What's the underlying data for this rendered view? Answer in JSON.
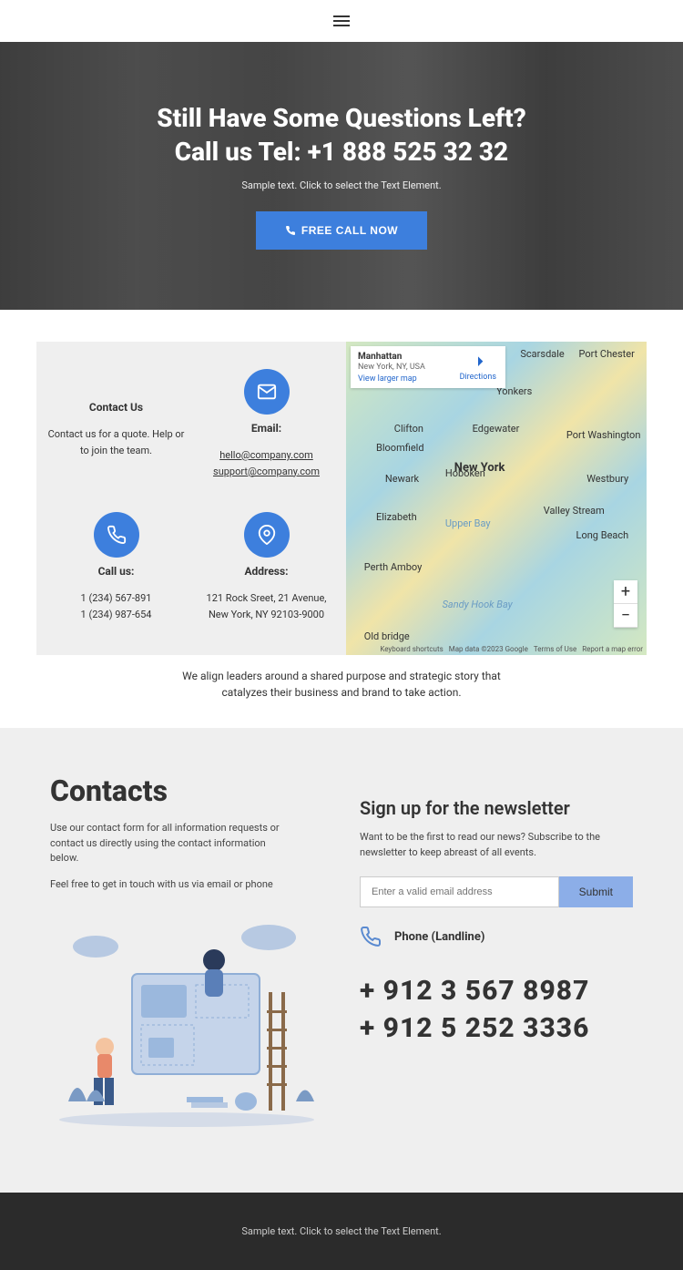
{
  "hero": {
    "title1": "Still Have Some Questions Left?",
    "title2": "Call us Tel: +1 888 525 32 32",
    "sub": "Sample text. Click to select the Text Element.",
    "btn": "FREE CALL NOW"
  },
  "contact": {
    "heading": "Contact Us",
    "intro": "Contact us for a quote. Help or to join the team.",
    "email": {
      "label": "Email:",
      "a1": "hello@company.com",
      "a2": "support@company.com"
    },
    "call": {
      "label": "Call us:",
      "p1": "1 (234) 567-891",
      "p2": "1 (234) 987-654"
    },
    "address": {
      "label": "Address:",
      "line": "121 Rock Sreet, 21 Avenue, New York, NY 92103-9000"
    },
    "under": "We align leaders around a shared purpose and strategic story that catalyzes their business and brand to take action."
  },
  "map": {
    "title": "Manhattan",
    "sub": "New York, NY, USA",
    "larger": "View larger map",
    "directions": "Directions",
    "center": "New York",
    "attr": {
      "k": "Keyboard shortcuts",
      "d": "Map data ©2023 Google",
      "t": "Terms of Use",
      "r": "Report a map error"
    },
    "places": {
      "scarsdale": "Scarsdale",
      "portchester": "Port Chester",
      "yonkers": "Yonkers",
      "clifton": "Clifton",
      "edgewater": "Edgewater",
      "bloomfield": "Bloomfield",
      "portwash": "Port Washington",
      "newark": "Newark",
      "hoboken": "Hoboken",
      "westbury": "Westbury",
      "elizabeth": "Elizabeth",
      "valleystream": "Valley Stream",
      "upperbay": "Upper Bay",
      "longbeach": "Long Beach",
      "pertham": "Perth Amboy",
      "sandyhook": "Sandy Hook Bay",
      "oldbridge": "Old bridge"
    }
  },
  "contacts2": {
    "title": "Contacts",
    "p1": "Use our contact form for all information requests or contact us directly using the contact information below.",
    "p2": "Feel free to get in touch with us via email or phone",
    "news_title": "Sign up for the newsletter",
    "news_desc": "Want to be the first to read our news? Subscribe to the newsletter to keep abreast of all events.",
    "placeholder": "Enter a valid email address",
    "submit": "Submit",
    "phone_label": "Phone (Landline)",
    "phone1": "+ 912 3 567 8987",
    "phone2": "+ 912 5 252 3336"
  },
  "footer": {
    "text": "Sample text. Click to select the Text Element."
  }
}
